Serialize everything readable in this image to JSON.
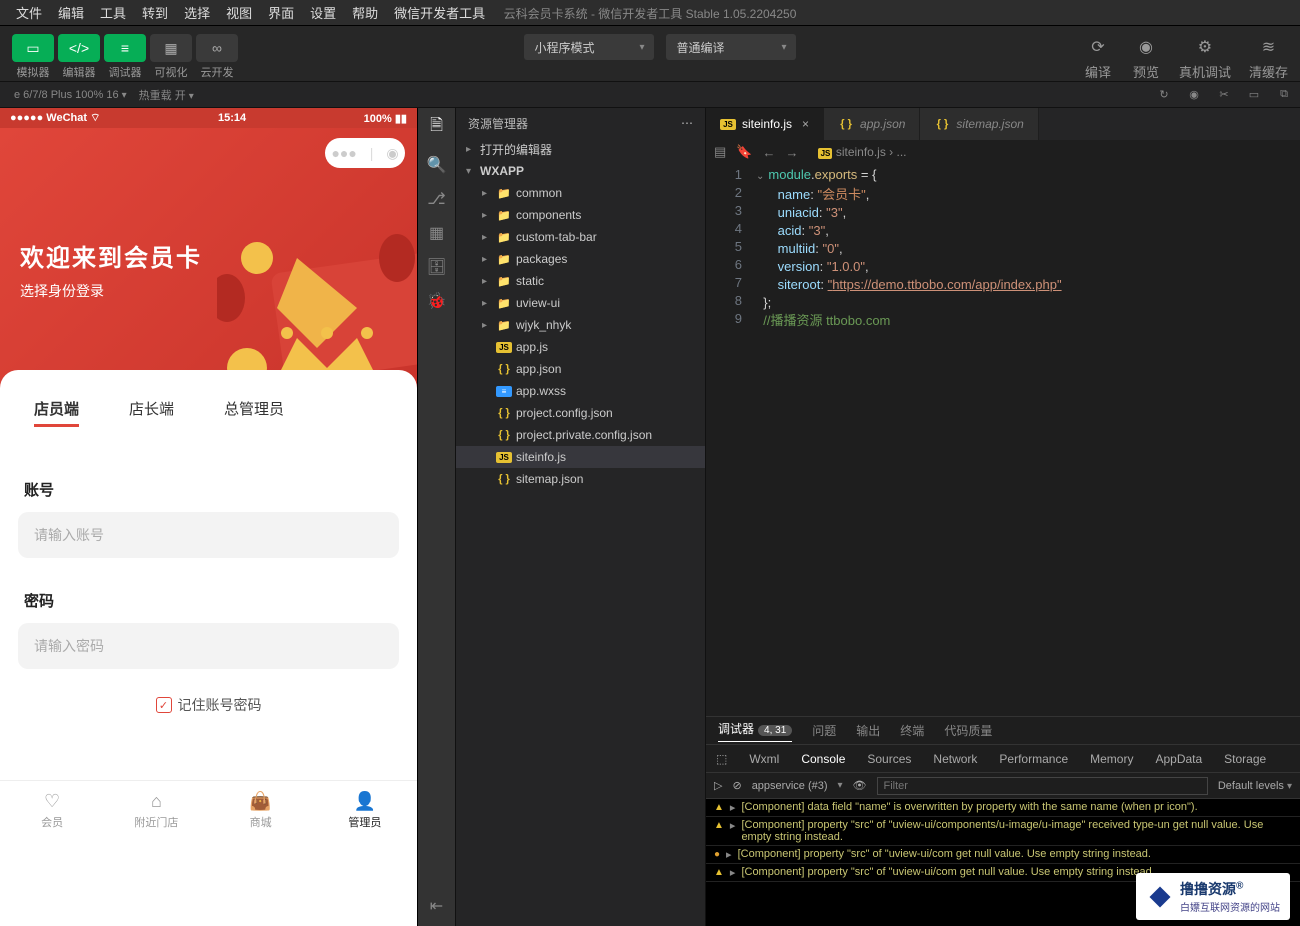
{
  "app_title": "云科会员卡系统 - 微信开发者工具 Stable 1.05.2204250",
  "menubar": [
    "文件",
    "编辑",
    "工具",
    "转到",
    "选择",
    "视图",
    "界面",
    "设置",
    "帮助",
    "微信开发者工具"
  ],
  "toolbar": {
    "buttons": [
      "模拟器",
      "编辑器",
      "调试器",
      "可视化",
      "云开发"
    ],
    "mode_select": "小程序模式",
    "compile_select": "普通编译",
    "right": [
      "编译",
      "预览",
      "真机调试",
      "清缓存"
    ]
  },
  "statusbar": {
    "device": "e 6/7/8 Plus 100% 16",
    "hot": "热重载 开"
  },
  "phone": {
    "carrier": "WeChat",
    "time": "15:14",
    "battery": "100%",
    "welcome_title": "欢迎来到会员卡",
    "welcome_sub": "选择身份登录",
    "role_tabs": [
      "店员端",
      "店长端",
      "总管理员"
    ],
    "account_label": "账号",
    "account_ph": "请输入账号",
    "password_label": "密码",
    "password_ph": "请输入密码",
    "remember": "记住账号密码",
    "tabbar": [
      "会员",
      "附近门店",
      "商城",
      "管理员"
    ]
  },
  "explorer": {
    "title": "资源管理器",
    "sections": [
      "打开的编辑器",
      "WXAPP"
    ],
    "tree": [
      {
        "name": "common",
        "type": "folder"
      },
      {
        "name": "components",
        "type": "folder"
      },
      {
        "name": "custom-tab-bar",
        "type": "folder"
      },
      {
        "name": "packages",
        "type": "folder"
      },
      {
        "name": "static",
        "type": "folder"
      },
      {
        "name": "uview-ui",
        "type": "folder"
      },
      {
        "name": "wjyk_nhyk",
        "type": "folder"
      },
      {
        "name": "app.js",
        "type": "js"
      },
      {
        "name": "app.json",
        "type": "json"
      },
      {
        "name": "app.wxss",
        "type": "wxss"
      },
      {
        "name": "project.config.json",
        "type": "json"
      },
      {
        "name": "project.private.config.json",
        "type": "json"
      },
      {
        "name": "siteinfo.js",
        "type": "js",
        "selected": true
      },
      {
        "name": "sitemap.json",
        "type": "json"
      }
    ]
  },
  "editor_tabs": [
    {
      "name": "siteinfo.js",
      "type": "js",
      "active": true
    },
    {
      "name": "app.json",
      "type": "json"
    },
    {
      "name": "sitemap.json",
      "type": "json"
    }
  ],
  "breadcrumb": "siteinfo.js › ...",
  "code": {
    "name_val": "会员卡",
    "uniacid_val": "3",
    "acid_val": "3",
    "multiid_val": "0",
    "version_val": "1.0.0",
    "siteroot_val": "https://demo.ttbobo.com/app/index.php",
    "comment": "//播播资源 ttbobo.com"
  },
  "bottom_tabs": {
    "debugger": "调试器",
    "badge": "4, 31",
    "problems": "问题",
    "output": "输出",
    "terminal": "终端",
    "quality": "代码质量"
  },
  "devtools_tabs": [
    "Wxml",
    "Console",
    "Sources",
    "Network",
    "Performance",
    "Memory",
    "AppData",
    "Storage"
  ],
  "console_toolbar": {
    "context": "appservice (#3)",
    "filter_ph": "Filter",
    "levels": "Default levels"
  },
  "console_lines": [
    "[Component] data field \"name\" is overwritten by property with the same name (when pr icon\").",
    "[Component] property \"src\" of \"uview-ui/components/u-image/u-image\" received type-un get null value. Use empty string instead.",
    "[Component] property \"src\" of \"uview-ui/com get null value. Use empty string instead.",
    "[Component] property \"src\" of \"uview-ui/com get null value. Use empty string instead."
  ],
  "watermark": {
    "title": "撸撸资源",
    "sub": "白嫖互联网资源的网站"
  }
}
